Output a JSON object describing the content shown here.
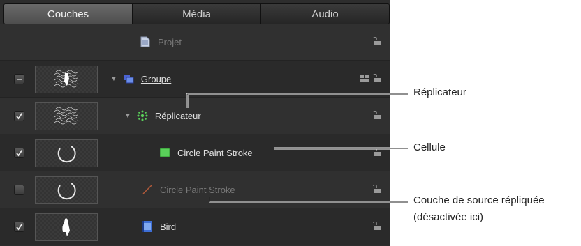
{
  "tabs": [
    {
      "label": "Couches",
      "active": true
    },
    {
      "label": "Média",
      "active": false
    },
    {
      "label": "Audio",
      "active": false
    }
  ],
  "rows": [
    {
      "name": "Projet",
      "check": "none",
      "thumb": "none",
      "icon": "project-icon",
      "disclosure": false,
      "dimmed": true
    },
    {
      "name": "Groupe",
      "check": "mixed",
      "thumb": "replicator-pattern",
      "icon": "group-icon",
      "disclosure": true,
      "underlined": true
    },
    {
      "name": "Réplicateur",
      "check": "checked",
      "thumb": "replicator-pattern",
      "icon": "replicator-icon",
      "disclosure": true
    },
    {
      "name": "Circle Paint Stroke",
      "check": "checked",
      "thumb": "circle-stroke",
      "icon": "green-square-icon",
      "disclosure": false
    },
    {
      "name": "Circle Paint Stroke",
      "check": "unchecked",
      "thumb": "circle-stroke",
      "icon": "paint-brush-icon",
      "disclosure": false,
      "dimmed": true
    },
    {
      "name": "Bird",
      "check": "checked",
      "thumb": "bird",
      "icon": "image-icon",
      "disclosure": false
    }
  ],
  "callouts": {
    "replicateur": "Réplicateur",
    "cellule": "Cellule",
    "source_line1": "Couche de source répliquée",
    "source_line2": "(désactivée ici)"
  },
  "colors": {
    "panel": "#2d2d2d",
    "accent_blue": "#6b8ee8",
    "green": "#5ad05a"
  }
}
